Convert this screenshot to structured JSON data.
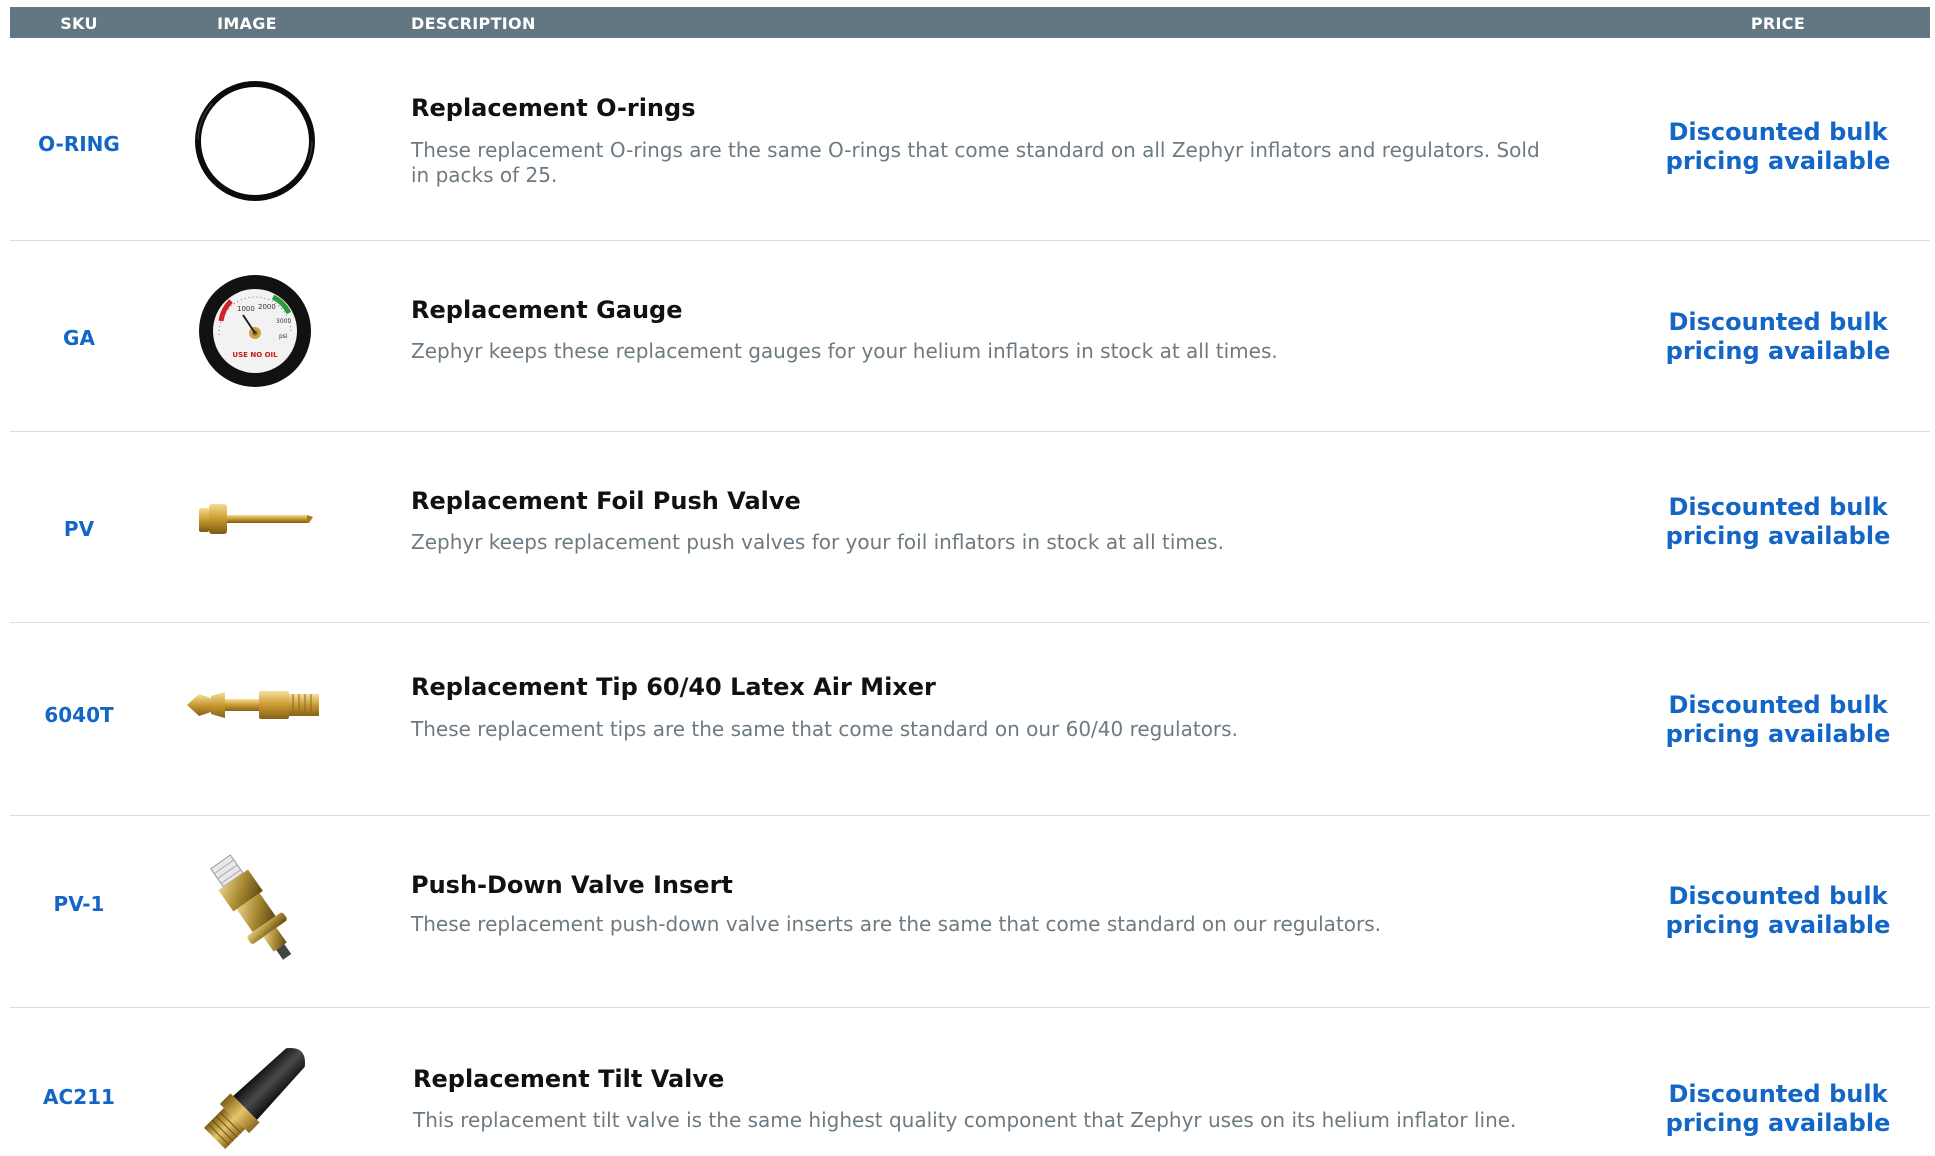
{
  "header": {
    "sku": "SKU",
    "image": "IMAGE",
    "description": "DESCRIPTION",
    "price": "PRICE"
  },
  "rows": [
    {
      "sku": "O-RING",
      "title": "Replacement O-rings",
      "description": "These replacement O-rings are the same O-rings that come standard on all Zephyr inflators and regulators. Sold in packs of 25.",
      "price": "Discounted bulk pricing available",
      "image_icon": "o-ring-icon"
    },
    {
      "sku": "GA",
      "title": "Replacement Gauge",
      "description": "Zephyr keeps these replacement gauges for your helium inflators in stock at all times.",
      "price": "Discounted bulk pricing available",
      "image_icon": "gauge-icon",
      "gauge_labels": [
        "1000",
        "2000",
        "3000",
        "psi",
        "USE NO OIL"
      ]
    },
    {
      "sku": "PV",
      "title": "Replacement Foil Push Valve",
      "description": "Zephyr keeps replacement push valves for your foil inflators in stock at all times.",
      "price": "Discounted bulk pricing available",
      "image_icon": "push-valve-icon"
    },
    {
      "sku": "6040T",
      "title": "Replacement Tip 60/40 Latex Air Mixer",
      "description": "These replacement tips are the same that come standard on our 60/40 regulators.",
      "price": "Discounted bulk pricing available",
      "image_icon": "tip-icon"
    },
    {
      "sku": "PV-1",
      "title": "Push-Down Valve Insert",
      "description": "These replacement push-down valve inserts are the same that come standard on our regulators.",
      "price": "Discounted bulk pricing available",
      "image_icon": "valve-insert-icon"
    },
    {
      "sku": "AC211",
      "title": "Replacement Tilt Valve",
      "description": "This replacement tilt valve is the same highest quality component that Zephyr uses on its helium inflator line.",
      "price": "Discounted bulk pricing available",
      "image_icon": "tilt-valve-icon"
    }
  ],
  "colors": {
    "header_bg": "#627782",
    "accent_blue": "#1366c6",
    "description_gray": "#6e7a82"
  }
}
